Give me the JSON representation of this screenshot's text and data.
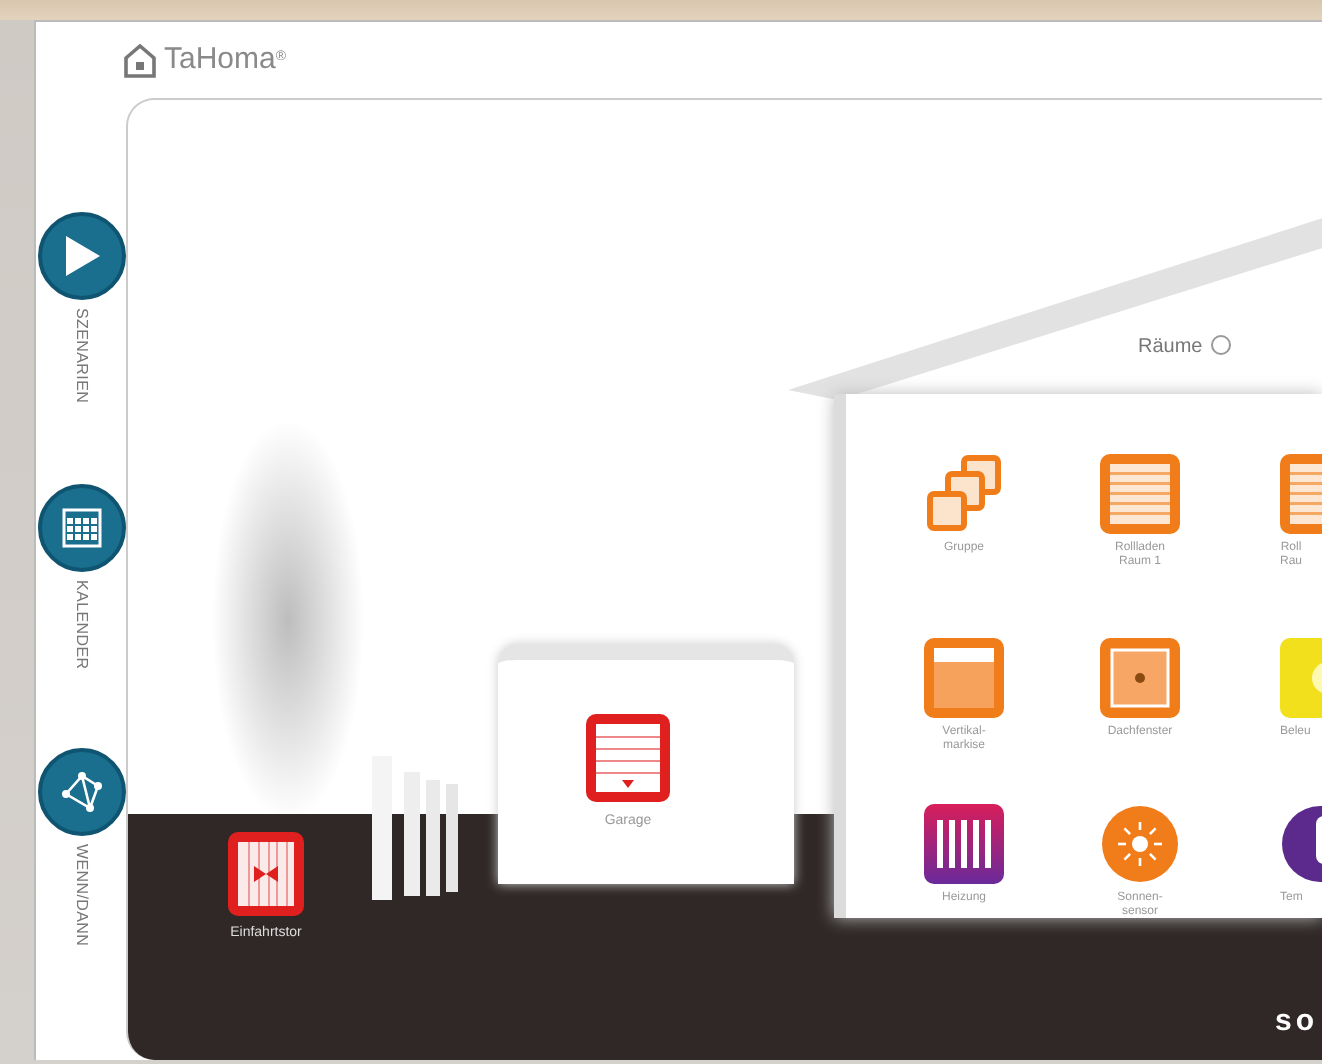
{
  "app": {
    "title": "TaHoma",
    "trademark": "®"
  },
  "sidebar": {
    "items": [
      {
        "label": "SZENARIEN",
        "kind": "play"
      },
      {
        "label": "KALENDER",
        "kind": "calendar"
      },
      {
        "label": "WENN/DANN",
        "kind": "network"
      }
    ]
  },
  "house": {
    "rooms_label": "Räume",
    "devices": [
      {
        "kind": "group",
        "label": "Gruppe"
      },
      {
        "kind": "shutter",
        "label": "Rollladen\nRaum 1"
      },
      {
        "kind": "shutter",
        "label": "Roll\nRau"
      },
      {
        "kind": "awning",
        "label": "Vertikal-\nmarkise"
      },
      {
        "kind": "skylight",
        "label": "Dachfenster"
      },
      {
        "kind": "light",
        "label": "Beleu"
      },
      {
        "kind": "heating",
        "label": "Heizung"
      },
      {
        "kind": "sun",
        "label": "Sonnen-\nsensor"
      },
      {
        "kind": "thermostat",
        "label": "Tem"
      }
    ]
  },
  "garage": {
    "label": "Garage"
  },
  "gate": {
    "label": "Einfahrtstor"
  },
  "brand": "so"
}
